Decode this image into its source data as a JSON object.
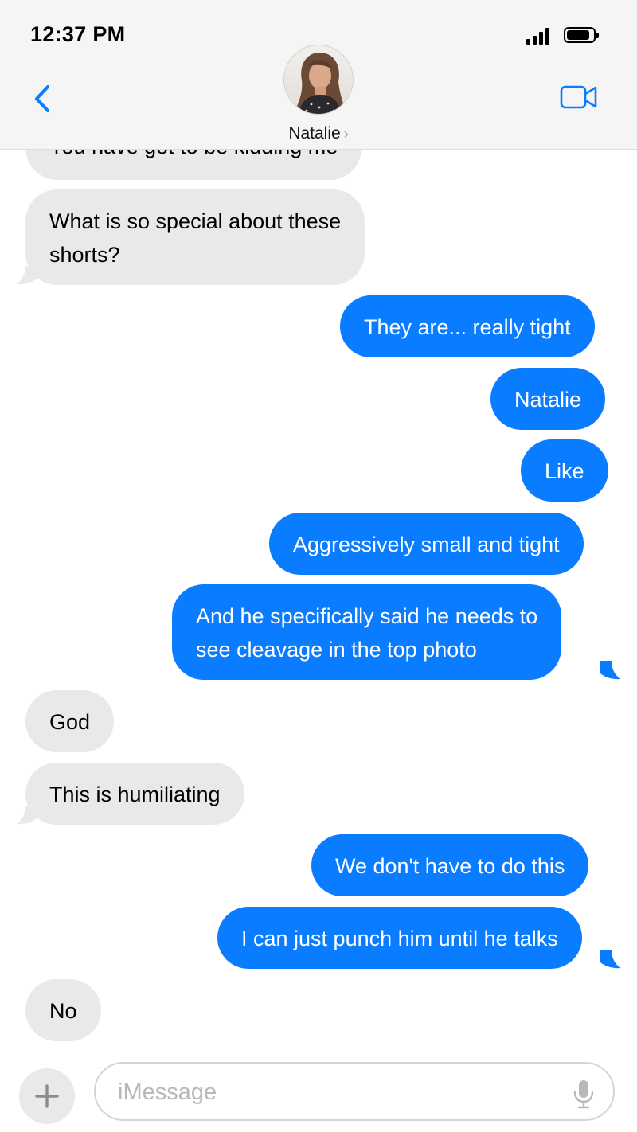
{
  "status_bar": {
    "time": "12:37 PM",
    "signal_icon": "cellular-signal-icon",
    "battery_icon": "battery-icon"
  },
  "header": {
    "contact_name": "Natalie",
    "back_icon": "chevron-left-icon",
    "video_icon": "video-camera-icon"
  },
  "colors": {
    "incoming_bubble": "#e9e9eb",
    "outgoing_bubble": "#0a7cff",
    "accent": "#0a7cff"
  },
  "messages": [
    {
      "direction": "in",
      "text": "You have got to be kidding me"
    },
    {
      "direction": "in",
      "lines": [
        "What is so special about these",
        "shorts?"
      ]
    },
    {
      "direction": "out",
      "text": "They are... really tight"
    },
    {
      "direction": "out",
      "text": "Natalie"
    },
    {
      "direction": "out",
      "text": "Like"
    },
    {
      "direction": "out",
      "text": "Aggressively small and tight"
    },
    {
      "direction": "out",
      "lines": [
        "And he specifically said he needs to",
        "see cleavage in the top photo"
      ]
    },
    {
      "direction": "in",
      "text": "God"
    },
    {
      "direction": "in",
      "text": "This is humiliating"
    },
    {
      "direction": "out",
      "text": "We don't have to do this"
    },
    {
      "direction": "out",
      "text": "I can just punch him until he talks"
    },
    {
      "direction": "in",
      "text": "No"
    }
  ],
  "composer": {
    "placeholder": "iMessage",
    "value": "",
    "add_icon": "plus-icon",
    "mic_icon": "microphone-icon"
  }
}
